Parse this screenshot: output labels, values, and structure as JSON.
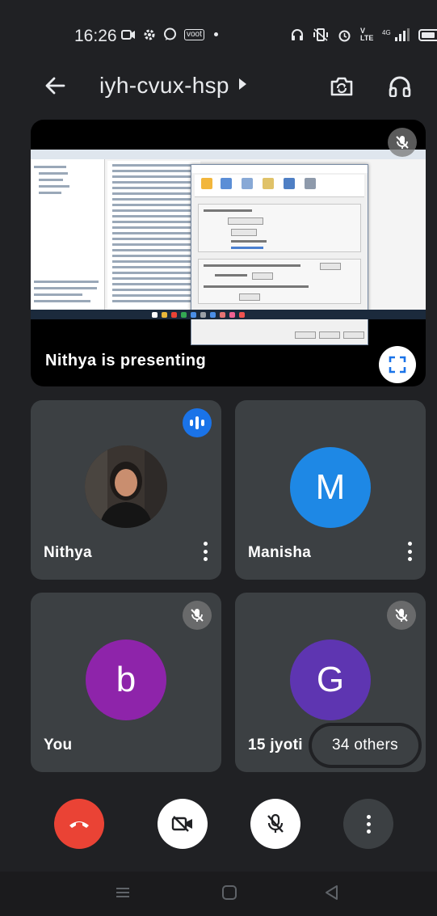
{
  "status_bar": {
    "time": "16:26",
    "left_icons": [
      "screen-record-icon",
      "gear-icon",
      "whatsapp-icon",
      "vodafone-icon",
      "dot-icon"
    ],
    "carrier_badge": "voot",
    "right_icons": [
      "headset-icon",
      "vibrate-icon",
      "alarm-icon",
      "volte-icon",
      "signal-icon",
      "battery-icon"
    ],
    "network_label": "4G"
  },
  "top_bar": {
    "meeting_code": "iyh-cvux-hsp",
    "icons": [
      "back-arrow-icon",
      "caret-right-icon",
      "switch-camera-icon",
      "headphones-icon"
    ]
  },
  "presentation": {
    "label": "Nithya is presenting",
    "icons": [
      "mic-off-icon",
      "fullscreen-icon"
    ]
  },
  "participants": [
    {
      "name": "Nithya",
      "avatar_type": "photo",
      "speaking": true,
      "muted": false
    },
    {
      "name": "Manisha",
      "avatar_type": "initial",
      "initial": "M",
      "avatar_color": "#1e88e5",
      "muted": false
    },
    {
      "name": "You",
      "avatar_type": "initial",
      "initial": "b",
      "avatar_color": "#8e24aa",
      "muted": true
    },
    {
      "name": "15 jyoti",
      "avatar_type": "initial",
      "initial": "G",
      "avatar_color": "#5e35b1",
      "muted": true
    }
  ],
  "others_count_label": "34 others",
  "controls": {
    "buttons": [
      "end-call-icon",
      "camera-off-icon",
      "mic-off-icon",
      "more-options-icon"
    ]
  },
  "colors": {
    "background": "#202124",
    "tile": "#3c4043",
    "end_call": "#ea4335",
    "speaking_blue": "#1a73e8"
  },
  "nav_bar": {
    "icons": [
      "recents-icon",
      "home-icon",
      "back-icon"
    ]
  }
}
